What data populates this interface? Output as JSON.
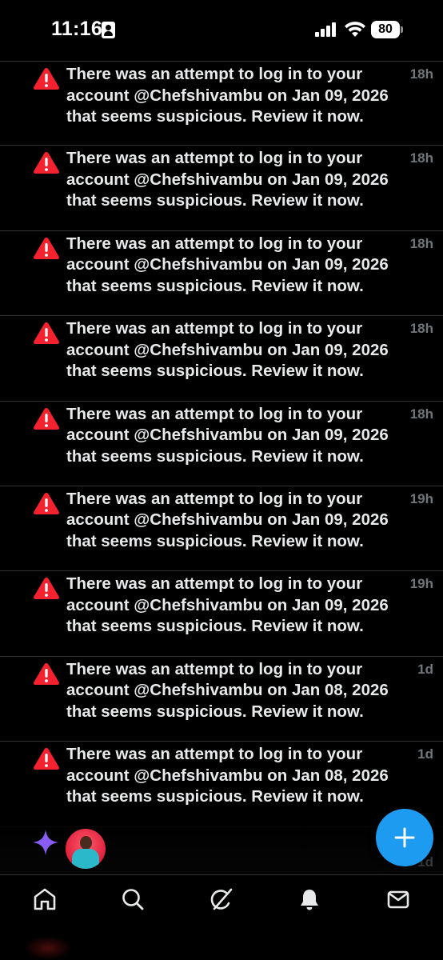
{
  "status_bar": {
    "time": "11:16",
    "battery": "80"
  },
  "notifications": [
    {
      "text": "There was an attempt to log in to your account @Chefshivambu on Jan 09, 2026 that seems suspicious. Review it now.",
      "time": "18h"
    },
    {
      "text": "There was an attempt to log in to your account @Chefshivambu on Jan 09, 2026 that seems suspicious. Review it now.",
      "time": "18h"
    },
    {
      "text": "There was an attempt to log in to your account @Chefshivambu on Jan 09, 2026 that seems suspicious. Review it now.",
      "time": "18h"
    },
    {
      "text": "There was an attempt to log in to your account @Chefshivambu on Jan 09, 2026 that seems suspicious. Review it now.",
      "time": "18h"
    },
    {
      "text": "There was an attempt to log in to your account @Chefshivambu on Jan 09, 2026 that seems suspicious. Review it now.",
      "time": "18h"
    },
    {
      "text": "There was an attempt to log in to your account @Chefshivambu on Jan 09, 2026 that seems suspicious. Review it now.",
      "time": "19h"
    },
    {
      "text": "There was an attempt to log in to your account @Chefshivambu on Jan 09, 2026 that seems suspicious. Review it now.",
      "time": "19h"
    },
    {
      "text": "There was an attempt to log in to your account @Chefshivambu on Jan 08, 2026 that seems suspicious. Review it now.",
      "time": "1d"
    },
    {
      "text": "There was an attempt to log in to your account @Chefshivambu on Jan 08, 2026 that seems suspicious. Review it now.",
      "time": "1d"
    }
  ],
  "partial_row_time": "1d",
  "icons": {
    "notification": "warning-triangle-icon",
    "grok": "grok-sparkle-icon",
    "fab": "plus-icon",
    "tabs": [
      "home-icon",
      "search-icon",
      "grok-slash-icon",
      "bell-icon",
      "mail-icon"
    ]
  },
  "colors": {
    "background": "#000000",
    "text": "#e7e9ea",
    "secondary_text": "#71767b",
    "divider": "#2f3336",
    "warning": "#f4212e",
    "accent": "#1d9bf0",
    "grok": "#8a5cf6"
  }
}
